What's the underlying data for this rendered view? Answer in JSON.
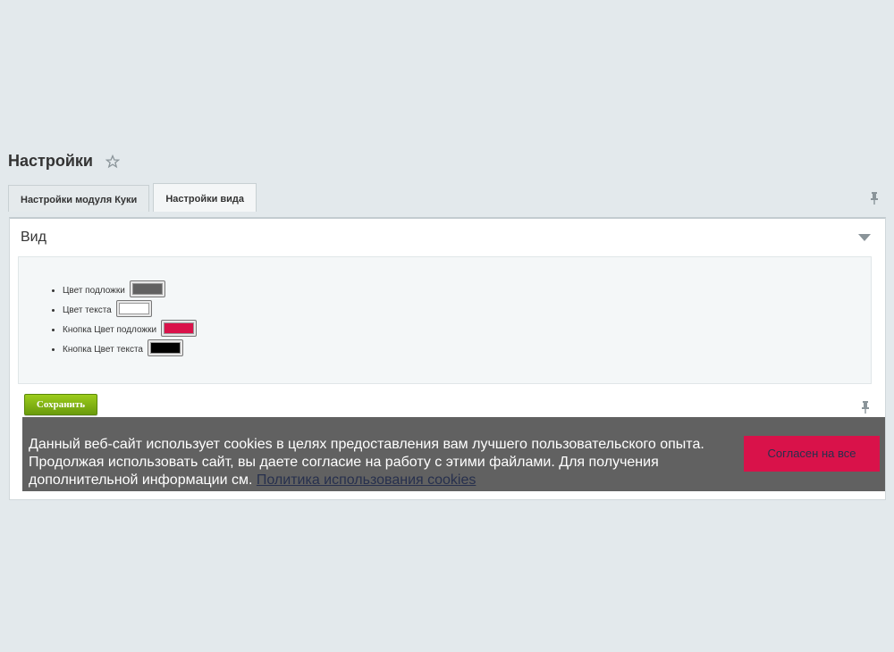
{
  "header": {
    "title": "Настройки",
    "favorite_icon": "star-icon"
  },
  "tabs": [
    {
      "label": "Настройки модуля Куки",
      "active": false
    },
    {
      "label": "Настройки вида",
      "active": true
    }
  ],
  "panel": {
    "section_title": "Вид",
    "collapse_icon": "chevron-down-icon",
    "pin_icon": "pin-icon",
    "settings": [
      {
        "label": "Цвет подложки",
        "color": "#616161"
      },
      {
        "label": "Цвет текста",
        "color": "#ffffff"
      },
      {
        "label": "Кнопка Цвет подложки",
        "color": "#d9124a"
      },
      {
        "label": "Кнопка Цвет текста",
        "color": "#000000"
      }
    ],
    "save_label": "Сохранить"
  },
  "cookie_banner": {
    "text_line1": "Данный веб-сайт использует cookies в целях предоставления вам лучшего пользовательского опыта.",
    "text_line2": "Продолжая использовать сайт, вы даете согласие на работу с этими файлами. Для получения",
    "text_line3": "дополнительной информации см.",
    "link_text": "Политика использования cookies",
    "accept_label": "Согласен на все",
    "background": "#616161",
    "button_color": "#d9124a"
  }
}
